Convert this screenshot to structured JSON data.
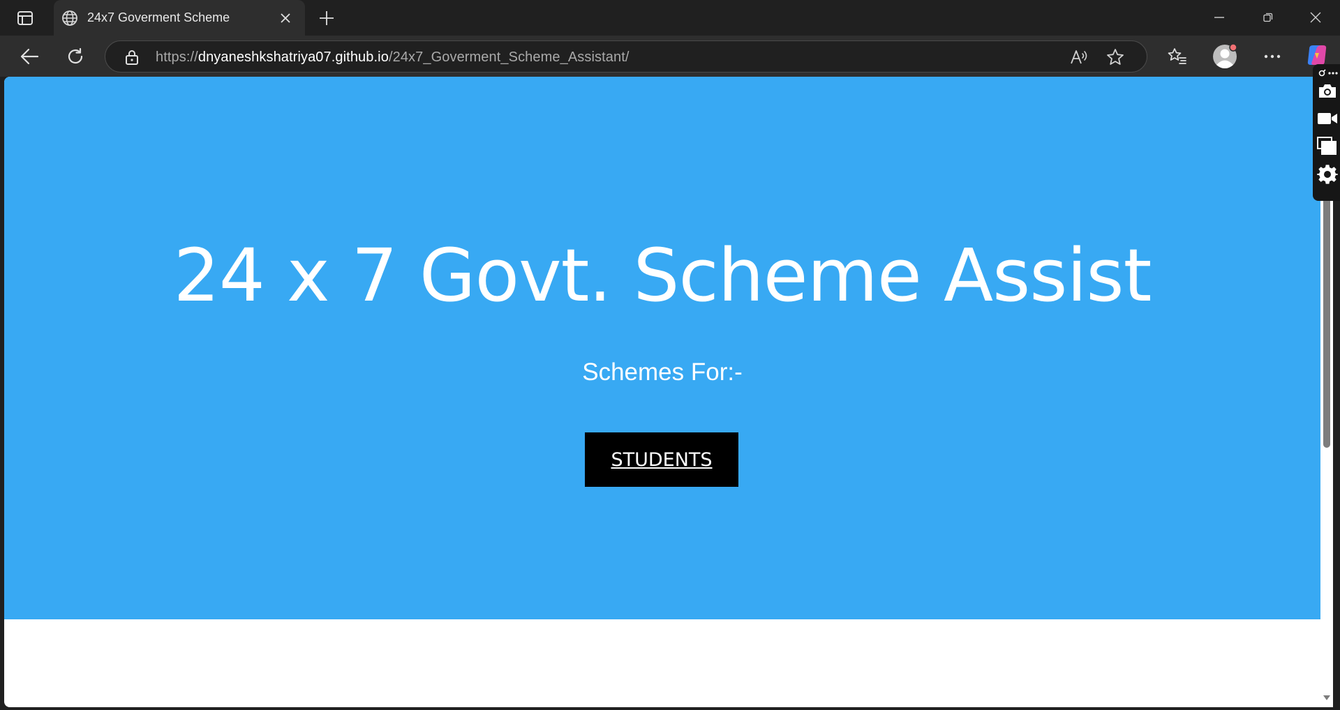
{
  "browser": {
    "tab": {
      "title": "24x7 Goverment Scheme"
    },
    "address": {
      "scheme": "https://",
      "host": "dnyaneshkshatriya07.github.io",
      "path": "/24x7_Goverment_Scheme_Assistant/"
    }
  },
  "page": {
    "title": "24 x 7 Govt. Scheme Assist",
    "subtitle": "Schemes For:-",
    "students_button": "STUDENTS"
  },
  "colors": {
    "hero_background": "#38a9f3",
    "button_background": "#000000",
    "profile_badge": "#f47174"
  }
}
